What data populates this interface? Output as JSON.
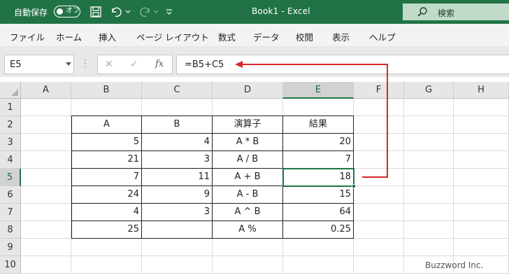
{
  "titlebar": {
    "autosave_label": "自動保存",
    "autosave_state": "オフ",
    "doc_title": "Book1  -  Excel",
    "search_label": "検索",
    "bg_color": "#217346"
  },
  "ribbon": {
    "tabs": [
      "ファイル",
      "ホーム",
      "挿入",
      "ページ レイアウト",
      "数式",
      "データ",
      "校閲",
      "表示",
      "ヘルプ"
    ]
  },
  "formula_bar": {
    "name_box": "E5",
    "fx": "fx",
    "formula": "=B5+C5"
  },
  "columns": [
    "A",
    "B",
    "C",
    "D",
    "E",
    "F",
    "G",
    "H"
  ],
  "rows": [
    "1",
    "2",
    "3",
    "4",
    "5",
    "6",
    "7",
    "8",
    "9",
    "10"
  ],
  "selected_cell": "E5",
  "table": {
    "header": [
      "A",
      "B",
      "演算子",
      "結果"
    ],
    "rows": [
      [
        "5",
        "4",
        "A * B",
        "20"
      ],
      [
        "21",
        "3",
        "A / B",
        "7"
      ],
      [
        "7",
        "11",
        "A + B",
        "18"
      ],
      [
        "24",
        "9",
        "A - B",
        "15"
      ],
      [
        "4",
        "3",
        "A ^ B",
        "64"
      ],
      [
        "25",
        "",
        "A %",
        "0.25"
      ]
    ]
  },
  "annotation": {
    "arrow_color": "#d9262b"
  },
  "watermark": "Buzzword Inc."
}
